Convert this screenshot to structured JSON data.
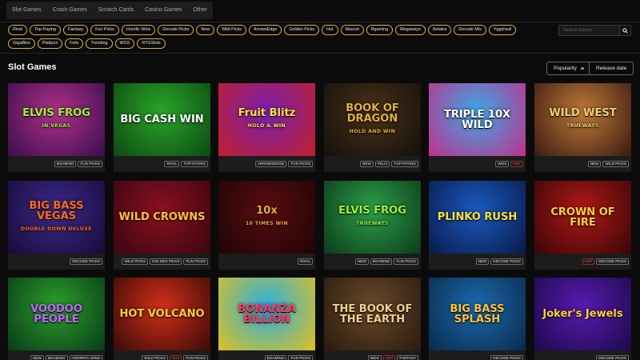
{
  "categories": [
    "Slot Games",
    "Crash Games",
    "Scratch Cards",
    "Casino Games",
    "Other"
  ],
  "filters": [
    "Rival",
    "Top-Paying",
    "Fantasy",
    "Fun Picks",
    "Horrific Wins",
    "Decode Picks",
    "New",
    "Wild Picks",
    "ArrowsEdge",
    "Golden Picks",
    "Hot",
    "Mascot",
    "Bgaming",
    "Megaways",
    "Betatra",
    "Decode Mix",
    "Yggdrasil",
    "GigaBlox",
    "Platipus",
    "Felix",
    "Trending",
    "WGS",
    "RTGSlots"
  ],
  "search": {
    "placeholder": "Search Games",
    "icon": "search-icon"
  },
  "section_title": "Slot Games",
  "sort": {
    "popularity_label": "Popularity",
    "release_label": "Release date"
  },
  "colors": {
    "accent": "#d8b24a",
    "hot": "#ff4a4a"
  },
  "games": [
    {
      "title": "ELVIS FROG",
      "sub": "IN VEGAS",
      "tags": [
        "BGAMING",
        "FUN PICKS"
      ],
      "bg": "#b0308a",
      "bg2": "#3a0f4a",
      "fg": "#9cf03a"
    },
    {
      "title": "BIG CASH WIN",
      "sub": "",
      "tags": [
        "RIVAL",
        "TOP-PAYING"
      ],
      "bg": "#2aa52a",
      "bg2": "#0d4a12",
      "fg": "#ffffff"
    },
    {
      "title": "Fruit Blitz",
      "sub": "HOLD & WIN",
      "tags": [
        "ARROWSEDGE",
        "FUN PICKS"
      ],
      "bg": "#7a1fb0",
      "bg2": "#c0202a",
      "fg": "#ffe14a"
    },
    {
      "title": "BOOK OF DRAGON",
      "sub": "HOLD AND WIN",
      "tags": [
        "NEW",
        "FELIX",
        "TOP-PAYING"
      ],
      "bg": "#4a3018",
      "bg2": "#14110c",
      "fg": "#e0b040"
    },
    {
      "title": "TRIPLE 10X WILD",
      "sub": "",
      "tags": [
        "WGS",
        "HOT"
      ],
      "bg": "#3aa8e8",
      "bg2": "#c0308a",
      "fg": "#ffffff"
    },
    {
      "title": "WILD WEST",
      "sub": "TRUEWAYS",
      "tags": [
        "NEW",
        "WILD PICKS"
      ],
      "bg": "#c07a3a",
      "bg2": "#3a1a10",
      "fg": "#f0d070"
    },
    {
      "title": "BIG BASS VEGAS",
      "sub": "DOUBLE DOWN DELUXE",
      "tags": [
        "DECODE PICKS"
      ],
      "bg": "#3a2a8a",
      "bg2": "#1a0a3a",
      "fg": "#ff6a1a"
    },
    {
      "title": "WILD CROWNS",
      "sub": "",
      "tags": [
        "WILD PICKS",
        "GOLDEN PICKS",
        "FUN PICKS"
      ],
      "bg": "#8a1020",
      "bg2": "#3a0610",
      "fg": "#ffc23a"
    },
    {
      "title": "10x",
      "sub": "10 TIMES WIN",
      "tags": [
        "RIVAL"
      ],
      "bg": "#5a0c10",
      "bg2": "#1e0406",
      "fg": "#e0b040"
    },
    {
      "title": "ELVIS FROG",
      "sub": "TRUEWAYS",
      "tags": [
        "NEW",
        "BGAMING",
        "FUN PICKS"
      ],
      "bg": "#2aa04a",
      "bg2": "#0d3a1a",
      "fg": "#9cf03a"
    },
    {
      "title": "PLINKO RUSH",
      "sub": "",
      "tags": [
        "NEW",
        "DECODE PICKS"
      ],
      "bg": "#1a5ac0",
      "bg2": "#0a1a4a",
      "fg": "#ffe03a"
    },
    {
      "title": "CROWN OF FIRE",
      "sub": "",
      "tags": [
        "HOT",
        "DECODE PICKS"
      ],
      "bg": "#b01818",
      "bg2": "#3a0606",
      "fg": "#ffd03a"
    },
    {
      "title": "VOODOO PEOPLE",
      "sub": "",
      "tags": [
        "NEW",
        "BGAMING",
        "HORRIFIC WINS"
      ],
      "bg": "#2aa02a",
      "bg2": "#0a3a1a",
      "fg": "#c06aff"
    },
    {
      "title": "HOT VOLCANO",
      "sub": "",
      "tags": [
        "WILD PICKS",
        "HOT",
        "FUN PICKS"
      ],
      "bg": "#d0301a",
      "bg2": "#3a0a06",
      "fg": "#ffd03a"
    },
    {
      "title": "BONANZA BILLION",
      "sub": "",
      "tags": [
        "BGAMING",
        "FUN PICKS"
      ],
      "bg": "#2ab0e0",
      "bg2": "#e0c020",
      "fg": "#ff3a6a"
    },
    {
      "title": "THE BOOK OF THE EARTH",
      "sub": "",
      "tags": [
        "WGS",
        "HOT",
        "FANTASY"
      ],
      "bg": "#6a4a2a",
      "bg2": "#2a1a0e",
      "fg": "#f0d090"
    },
    {
      "title": "BIG BASS SPLASH",
      "sub": "",
      "tags": [
        "DECODE PICKS"
      ],
      "bg": "#1a6ab0",
      "bg2": "#0a2a4a",
      "fg": "#ffc23a"
    },
    {
      "title": "Joker's Jewels",
      "sub": "",
      "tags": [
        "DECODE PICKS"
      ],
      "bg": "#5a1ab0",
      "bg2": "#1a0a4a",
      "fg": "#ffd03a"
    }
  ]
}
